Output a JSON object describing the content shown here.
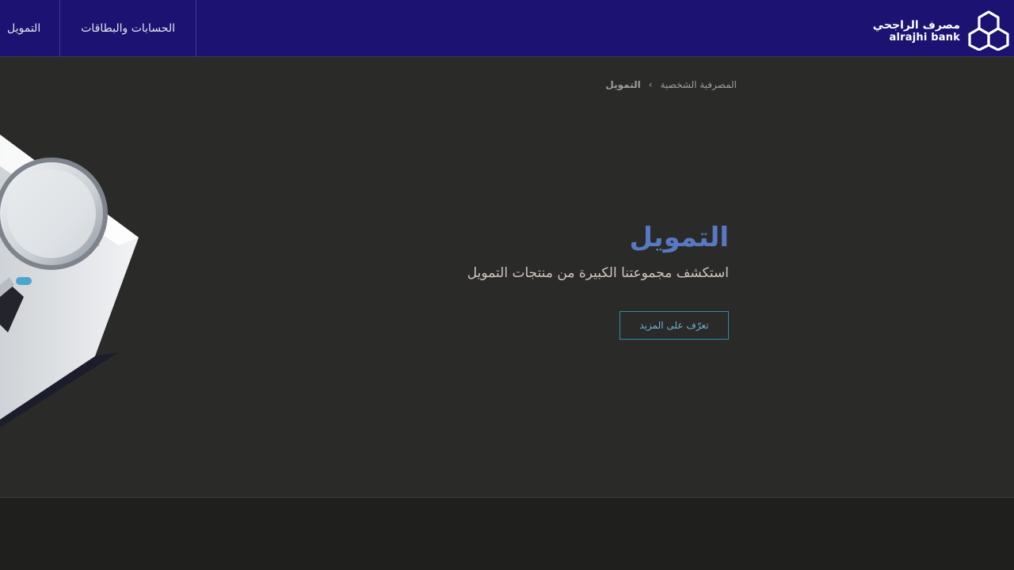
{
  "header": {
    "logo": {
      "arabic": "مصرف الراجحي",
      "latin": "alrajhi bank",
      "icon": "alrajhi-hexagon-logo"
    },
    "nav": [
      {
        "label": "الحسابات والبطاقات"
      },
      {
        "label": "التمويل"
      }
    ]
  },
  "breadcrumb": {
    "parent": "المصرفية الشخصية",
    "separator": "›",
    "current": "التمويل"
  },
  "hero": {
    "title": "التمويل",
    "subtitle": "استكشف مجموعتنا الكبيرة من منتجات التمويل",
    "cta_label": "تعرّف على المزيد",
    "image": "magnifying-glass-document-illustration"
  },
  "colors": {
    "header_bg": "#1b1272",
    "page_bg": "#2a2a29",
    "title": "#5878c2",
    "cta_border": "#2f8ea8",
    "footer_bg": "#1f1f1e"
  }
}
